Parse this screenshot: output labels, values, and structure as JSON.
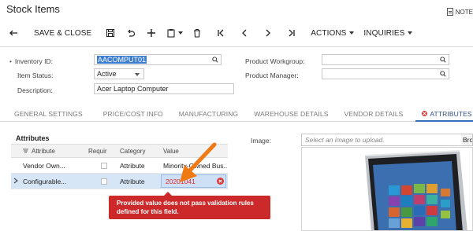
{
  "window": {
    "title": "Stock Items",
    "notes_label": "NOTE"
  },
  "toolbar": {
    "save_close_label": "SAVE & CLOSE",
    "actions_label": "ACTIONS",
    "inquiries_label": "INQUIRIES"
  },
  "form": {
    "inventory_id_label": "Inventory ID:",
    "inventory_id_value": "AACOMPUT01",
    "item_status_label": "Item Status:",
    "item_status_value": "Active",
    "description_label": "Description:",
    "description_value": "Acer Laptop Computer",
    "product_workgroup_label": "Product Workgroup:",
    "product_workgroup_value": "",
    "product_manager_label": "Product Manager:",
    "product_manager_value": ""
  },
  "tabs": [
    {
      "label": "GENERAL SETTINGS"
    },
    {
      "label": "PRICE/COST INFO"
    },
    {
      "label": "MANUFACTURING"
    },
    {
      "label": "WAREHOUSE DETAILS"
    },
    {
      "label": "VENDOR DETAILS"
    },
    {
      "label": "ATTRIBUTES"
    }
  ],
  "attributes": {
    "title": "Attributes",
    "columns": {
      "attribute": "Attribute",
      "required": "Requir",
      "category": "Category",
      "value": "Value"
    },
    "rows": [
      {
        "attribute": "Vendor Own...",
        "category": "Attribute",
        "value": "Minority-Owned Bus..."
      },
      {
        "attribute": "Configurable...",
        "category": "Attribute",
        "value": "20201041"
      }
    ],
    "error_message_line1": "Provided value does not pass validation rules",
    "error_message_line2": "defined for this field."
  },
  "image": {
    "label": "Image:",
    "placeholder": "Select an image to upload.",
    "browse_label": "Bro"
  },
  "colors": {
    "accent": "#3571b9",
    "error": "#cc2a2a",
    "annotation_arrow": "#f07a14",
    "selection": "#3d7ed0"
  }
}
